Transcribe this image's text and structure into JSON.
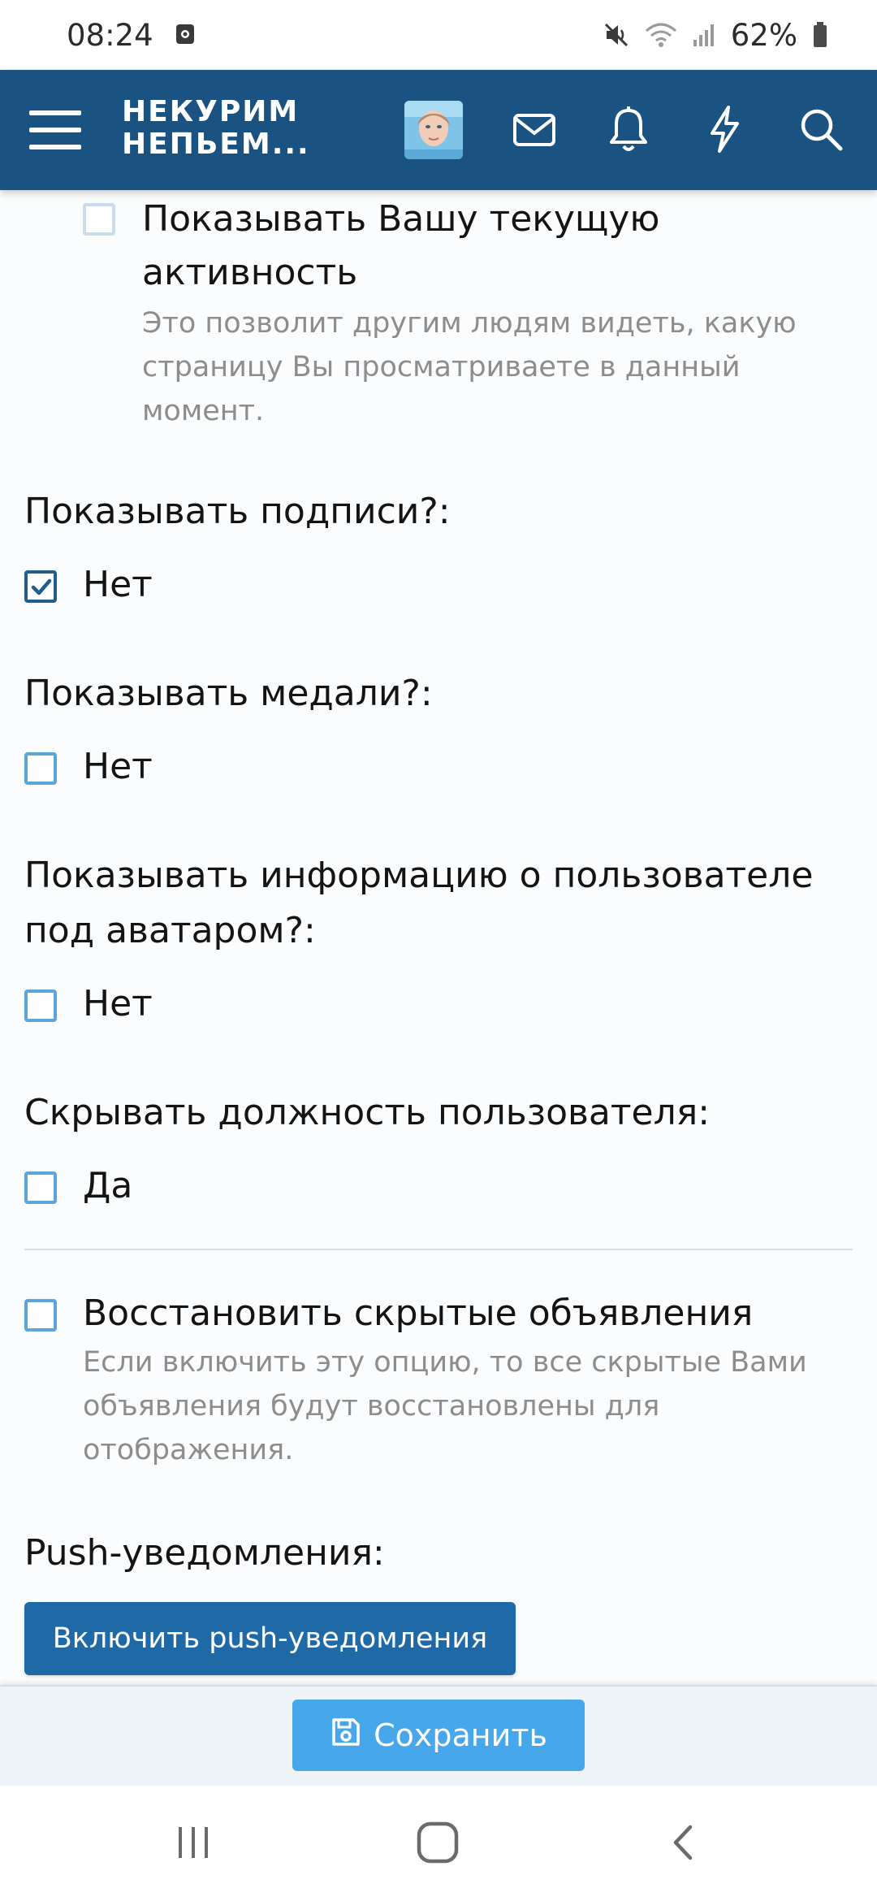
{
  "status_bar": {
    "time": "08:24",
    "battery_percent": "62%",
    "icons": [
      "notification-icon",
      "mute-icon",
      "wifi-icon",
      "signal-icon",
      "battery-icon"
    ]
  },
  "header": {
    "logo_line1": "НЕКУРИМ",
    "logo_line2": "НЕПЬЕМ...",
    "icons": [
      "menu-icon",
      "avatar",
      "mail-icon",
      "bell-icon",
      "lightning-icon",
      "search-icon"
    ],
    "background_color": "#1a5381"
  },
  "settings": {
    "activity": {
      "label_line1": "Показывать Вашу текущую",
      "label_line2": "активность",
      "hint_line1": "Это позволит другим людям видеть, какую",
      "hint_line2": "страницу Вы просматриваете в данный",
      "hint_line3": "момент.",
      "checked": false
    },
    "signatures": {
      "label": "Показывать подписи?:",
      "option": "Нет",
      "checked": true
    },
    "medals": {
      "label": "Показывать медали?:",
      "option": "Нет",
      "checked": false
    },
    "user_info": {
      "label_line1": "Показывать информацию о пользователе",
      "label_line2": "под аватаром?:",
      "option": "Нет",
      "checked": false
    },
    "hide_title": {
      "label": "Скрывать должность пользователя:",
      "option": "Да",
      "checked": false
    },
    "restore_notices": {
      "label": "Восстановить скрытые объявления",
      "hint_line1": "Если включить эту опцию, то все скрытые Вами",
      "hint_line2": "объявления будут восстановлены для",
      "hint_line3": "отображения.",
      "checked": false
    },
    "push": {
      "label": "Push-уведомления:",
      "button": "Включить push-уведомления"
    }
  },
  "save_bar": {
    "save_label": "Сохранить",
    "accent_color": "#47a7eb"
  },
  "nav_bar": {
    "icons": [
      "recent-apps-icon",
      "home-icon",
      "back-icon"
    ]
  }
}
